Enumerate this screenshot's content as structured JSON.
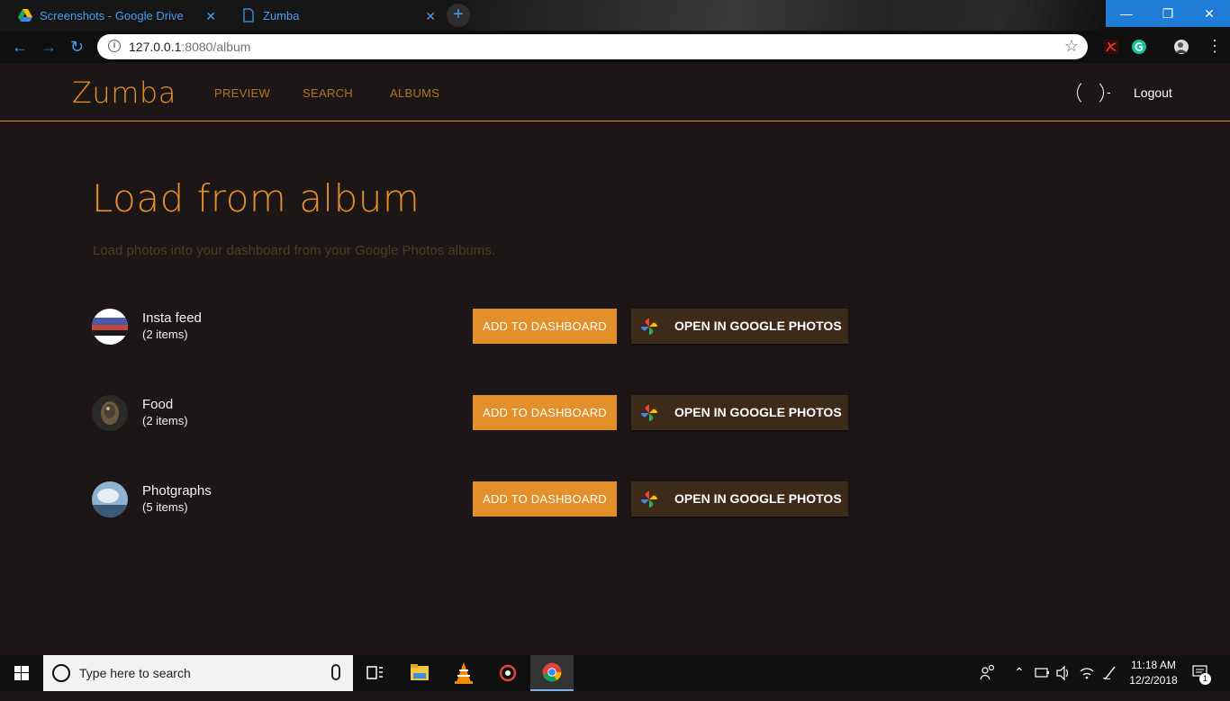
{
  "browser": {
    "tabs": [
      {
        "title": "Screenshots - Google Drive",
        "icon": "google-drive-icon"
      },
      {
        "title": "Zumba",
        "icon": "document-icon"
      }
    ],
    "url_host": "127.0.0.1",
    "url_rest": ":8080/album"
  },
  "app": {
    "brand": "Zumba",
    "nav": [
      "PREVIEW",
      "SEARCH",
      "ALBUMS"
    ],
    "user_separator": "-",
    "logout_label": "Logout"
  },
  "page": {
    "title": "Load from album",
    "subtitle": "Load photos into your dashboard from your Google Photos albums."
  },
  "albums": [
    {
      "name": "Insta feed",
      "count": "(2 items)",
      "add_label": "ADD TO DASHBOARD",
      "open_label": "OPEN IN GOOGLE PHOTOS"
    },
    {
      "name": "Food",
      "count": "(2 items)",
      "add_label": "ADD TO DASHBOARD",
      "open_label": "OPEN IN GOOGLE PHOTOS"
    },
    {
      "name": "Photgraphs",
      "count": "(5 items)",
      "add_label": "ADD TO DASHBOARD",
      "open_label": "OPEN IN GOOGLE PHOTOS"
    }
  ],
  "taskbar": {
    "search_placeholder": "Type here to search",
    "time": "11:18 AM",
    "date": "12/2/2018",
    "notification_count": "1"
  },
  "colors": {
    "accent": "#e38f2a",
    "background": "#1c1716",
    "open_button": "#3e2a18"
  }
}
